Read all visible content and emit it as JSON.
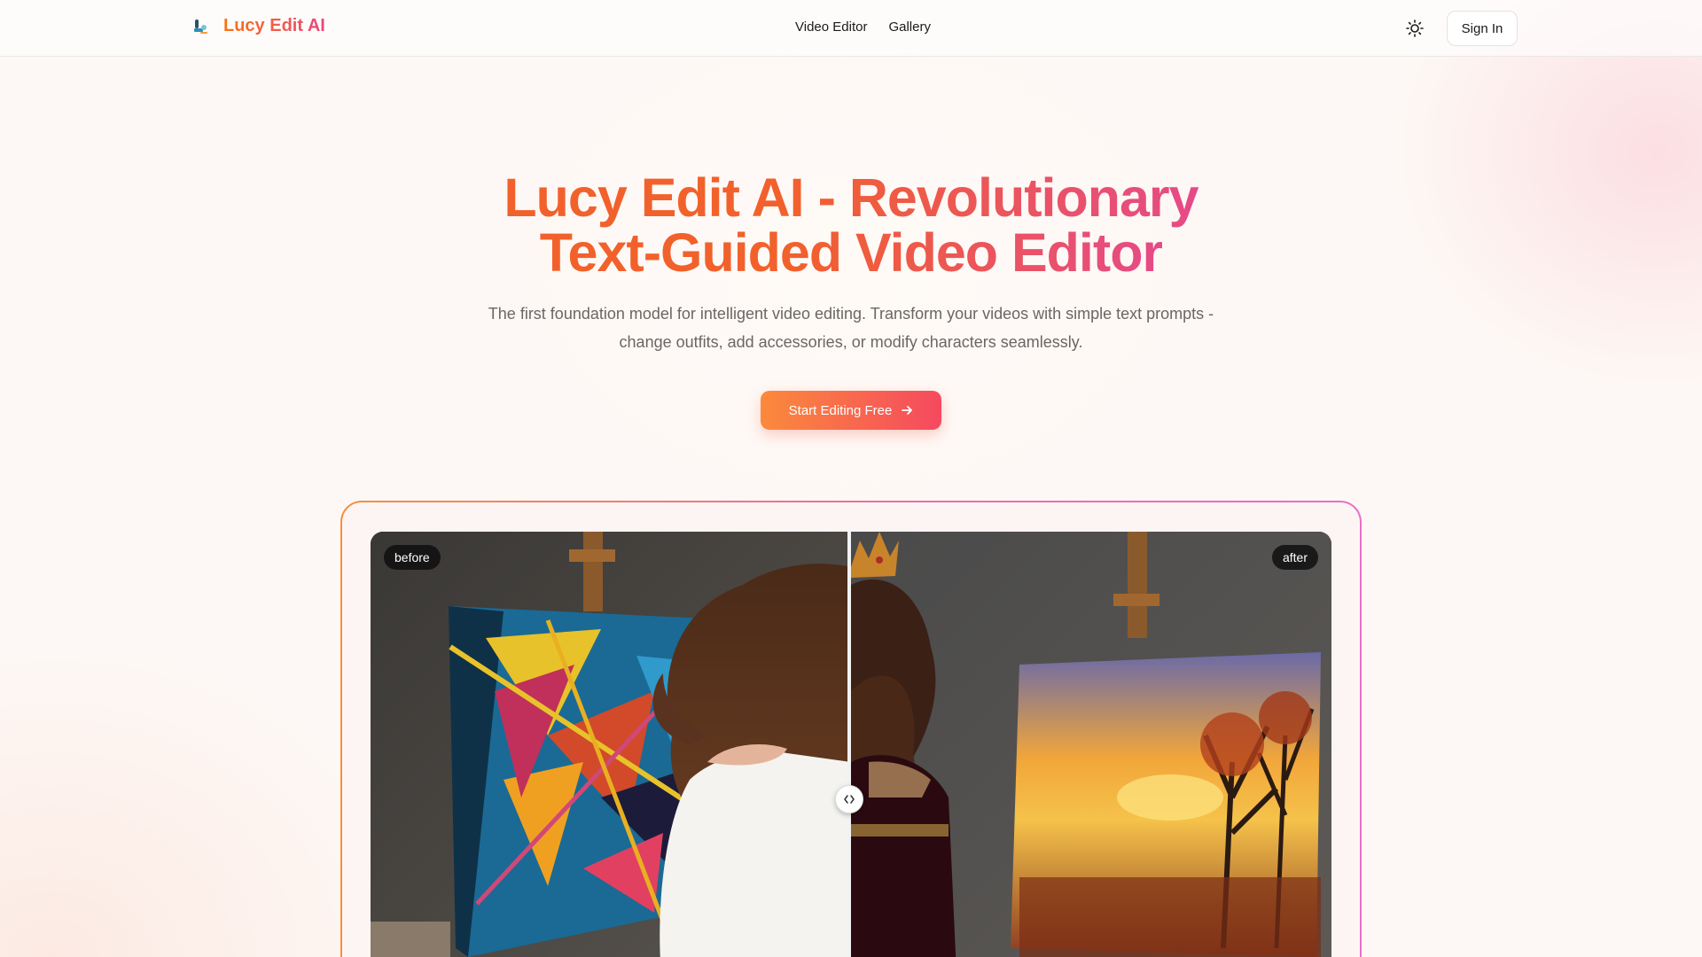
{
  "header": {
    "brand_name": "Lucy Edit AI",
    "nav": {
      "video_editor": "Video Editor",
      "gallery": "Gallery"
    },
    "sign_in_label": "Sign In",
    "theme_icon": "sun-icon"
  },
  "hero": {
    "title_line1": "Lucy Edit AI - Revolutionary",
    "title_line2": "Text-Guided Video Editor",
    "subtitle_line1": "The first foundation model for intelligent video editing. Transform your videos with simple text prompts -",
    "subtitle_line2": "change outfits, add accessories, or modify characters seamlessly.",
    "cta_label": "Start Editing Free",
    "cta_icon": "arrow-right-icon"
  },
  "compare": {
    "before_label": "before",
    "after_label": "after",
    "slider_position": 0.5
  },
  "colors": {
    "accent_orange": "#f97316",
    "accent_pink": "#e8477b"
  }
}
